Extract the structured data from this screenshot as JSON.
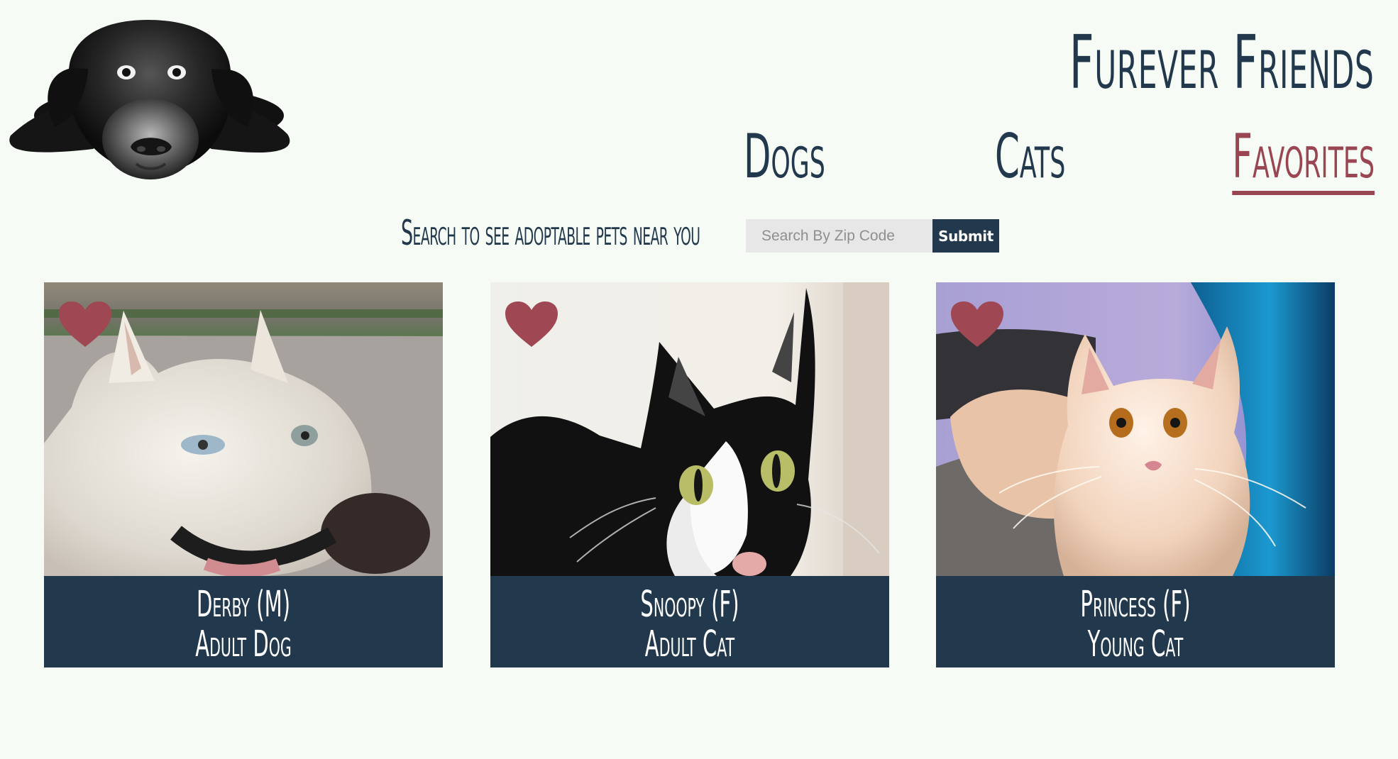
{
  "header": {
    "site_title": "Furever Friends",
    "logo": "black-dog-logo"
  },
  "nav": {
    "items": [
      {
        "label": "Dogs"
      },
      {
        "label": "Cats"
      },
      {
        "label": "Favorites",
        "active": true
      }
    ]
  },
  "search": {
    "label": "Search to see adoptable pets near you",
    "input_value": "",
    "placeholder": "Search By Zip Code",
    "submit_label": "Submit"
  },
  "pets": [
    {
      "name_line": "Derby (M)",
      "type_line": "Adult Dog",
      "favorite_icon": "heart-icon",
      "photo": "white-husky-dog-photo"
    },
    {
      "name_line": "Snoopy (F)",
      "type_line": "Adult Cat",
      "favorite_icon": "heart-icon",
      "photo": "black-white-cat-photo"
    },
    {
      "name_line": "Princess (F)",
      "type_line": "Young Cat",
      "favorite_icon": "heart-icon",
      "photo": "cream-cat-photo"
    }
  ],
  "colors": {
    "background": "#f6fcf5",
    "navy": "#22384d",
    "accent_rose": "#9a4652",
    "input_bg": "#e7e7e7"
  }
}
